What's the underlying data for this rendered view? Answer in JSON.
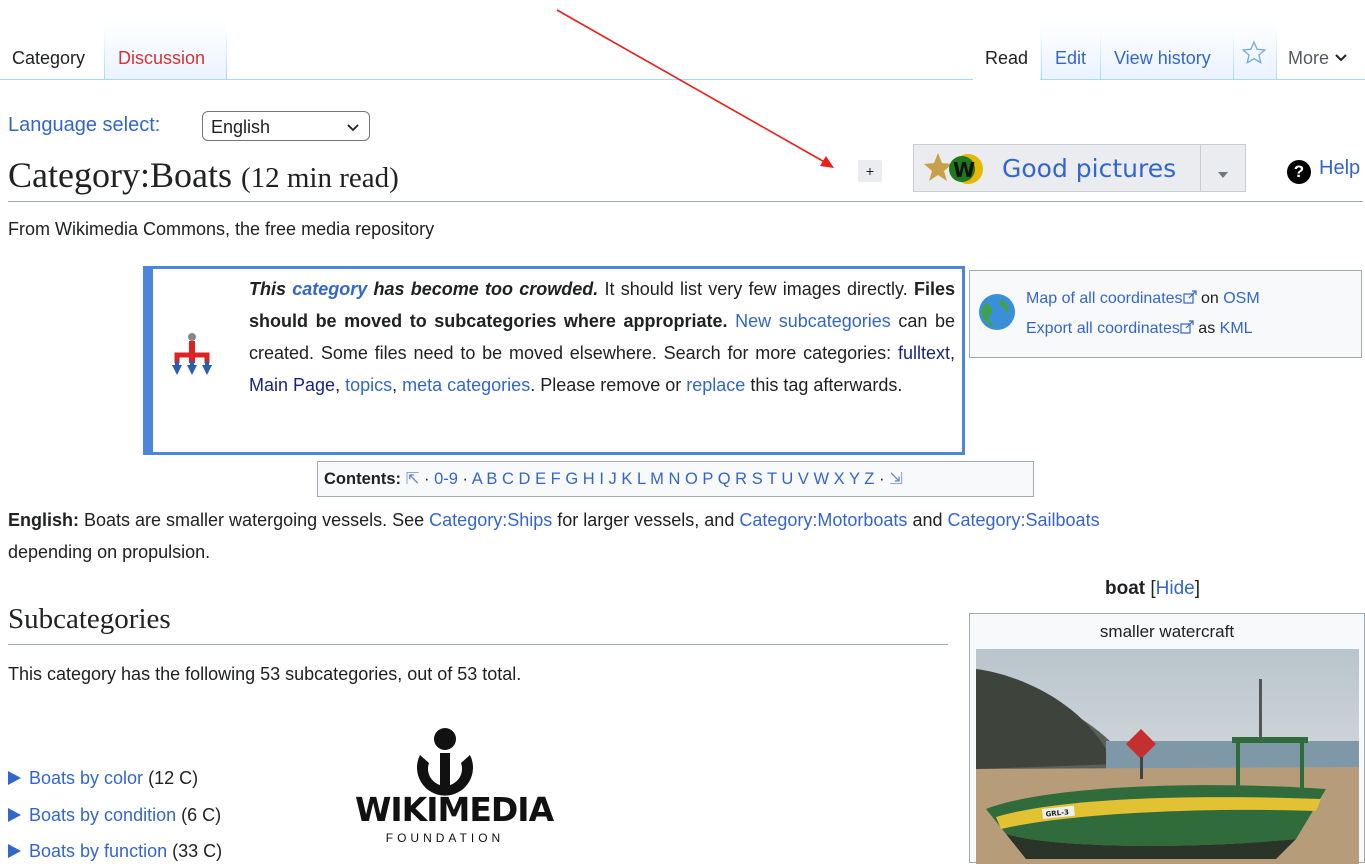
{
  "tabs": {
    "category": "Category",
    "discussion": "Discussion",
    "read": "Read",
    "edit": "Edit",
    "view_history": "View history",
    "more": "More"
  },
  "language_select": {
    "label": "Language select:",
    "value": "English"
  },
  "page": {
    "title": "Category:Boats",
    "read_time": "(12 min read)",
    "plus_label": "+",
    "good_pictures": "Good pictures",
    "help": "Help",
    "tagline": "From Wikimedia Commons, the free media repository"
  },
  "crowded_notice": {
    "t1": "This ",
    "t2": "category",
    "t3": " has become too crowded.",
    "t4": " It should list very few images directly. ",
    "t5": "Files should be moved to subcategories where appropriate.",
    "t6": "New subcategories",
    "t7": " can be created. Some files need to be moved elsewhere. Search for more categories: ",
    "t8": "fulltext",
    "t9": ", ",
    "t10": "Main Page",
    "t11": ", ",
    "t12": "topics",
    "t13": ", ",
    "t14": "meta categories",
    "t15": ". Please remove or ",
    "t16": "replace",
    "t17": " this tag afterwards."
  },
  "coords": {
    "map_link": "Map of all coordinates",
    "map_on": " on ",
    "osm": "OSM",
    "export_link": "Export all coordinates",
    "export_as": " as ",
    "kml": "KML"
  },
  "toc": {
    "label": "Contents:",
    "top": "⇱",
    "sep": "·",
    "digits": "0-9",
    "letters": [
      "A",
      "B",
      "C",
      "D",
      "E",
      "F",
      "G",
      "H",
      "I",
      "J",
      "K",
      "L",
      "M",
      "N",
      "O",
      "P",
      "Q",
      "R",
      "S",
      "T",
      "U",
      "V",
      "W",
      "X",
      "Y",
      "Z"
    ],
    "bottom": "⇲"
  },
  "description": {
    "lang": "English:",
    "t1": " Boats are smaller watergoing vessels. See ",
    "ships": "Category:Ships",
    "t2": " for larger vessels, and ",
    "motorboats": "Category:Motorboats",
    "t3": " and ",
    "sailboats": "Category:Sailboats",
    "t4": "depending on propulsion."
  },
  "subcategories": {
    "heading": "Subcategories",
    "count_text": "This category has the following 53 subcategories, out of 53 total.",
    "items": [
      {
        "name": "Boats by color",
        "count": "(12 C)"
      },
      {
        "name": "Boats by condition",
        "count": "(6 C)"
      },
      {
        "name": "Boats by function",
        "count": "(33 C)"
      }
    ]
  },
  "wikimedia": {
    "name": "WIKIMEDIA",
    "sub": "FOUNDATION"
  },
  "infobox": {
    "title": "boat",
    "hide_open": "[",
    "hide": "Hide",
    "hide_close": "]",
    "caption": "smaller watercraft",
    "boat_label": "GRL-3"
  },
  "colors": {
    "link": "#3366cc",
    "red_link": "#d73333",
    "notice_border": "#4b86da",
    "arrow": "#e8201b"
  }
}
